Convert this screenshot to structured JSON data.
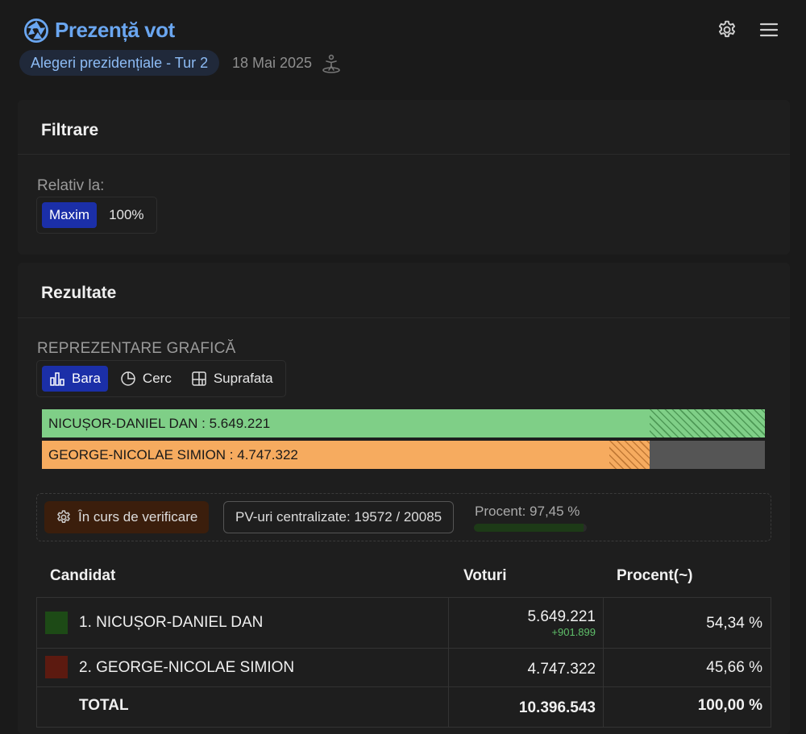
{
  "app": {
    "title": "Prezență vot"
  },
  "header": {
    "election": "Alegeri prezidențiale - Tur 2",
    "date": "18 Mai 2025"
  },
  "filter": {
    "title": "Filtrare",
    "relative_label": "Relativ la:",
    "options": [
      "Maxim",
      "100%"
    ],
    "selected": "Maxim"
  },
  "results": {
    "title": "Rezultate",
    "repr_label": "REPREZENTARE GRAFICĂ",
    "chart_types": [
      "Bara",
      "Cerc",
      "Suprafata"
    ],
    "selected_chart": "Bara",
    "bars": [
      {
        "label": "NICUȘOR-DANIEL DAN : 5.649.221",
        "value": 5649221,
        "delta": 901899,
        "color": "#7fcf87",
        "hatch_color": "#4f9a57"
      },
      {
        "label": "GEORGE-NICOLAE SIMION : 4.747.322",
        "value": 4747322,
        "delta": 0,
        "color": "#f6ab5f",
        "hatch_color": "#c27a36"
      }
    ],
    "status": {
      "verification": "În curs de verificare",
      "pv_text": "PV-uri centralizate: 19572 / 20085",
      "percent_text": "Procent: 97,45 %",
      "percent_value": 97.45
    },
    "table": {
      "headers": [
        "Candidat",
        "Voturi",
        "Procent(~)"
      ],
      "rows": [
        {
          "name": "1. NICUȘOR-DANIEL DAN",
          "votes": "5.649.221",
          "delta": "+901.899",
          "percent": "54,34 %",
          "color": "#1d4a16"
        },
        {
          "name": "2. GEORGE-NICOLAE SIMION",
          "votes": "4.747.322",
          "delta": "",
          "percent": "45,66 %",
          "color": "#5c1a10"
        }
      ],
      "total": {
        "name": "TOTAL",
        "votes": "10.396.543",
        "percent": "100,00 %"
      }
    }
  }
}
